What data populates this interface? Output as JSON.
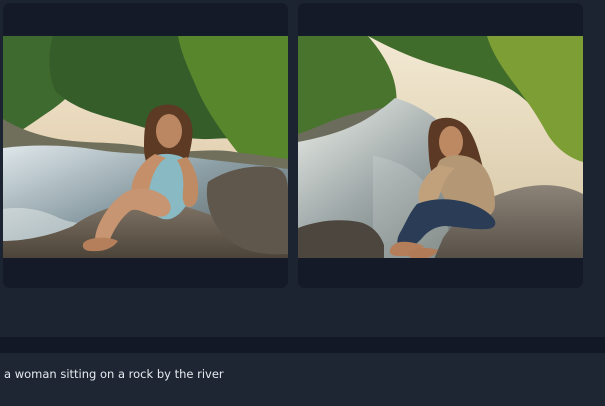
{
  "gallery": {
    "images": [
      {
        "id": "left",
        "scene": "woman-sitting-on-rock-by-river-front-view"
      },
      {
        "id": "right",
        "scene": "woman-sitting-on-rock-by-river-side-view"
      }
    ]
  },
  "prompt": {
    "text": "a woman sitting on a rock by the river"
  },
  "colors": {
    "background": "#1c2431",
    "card": "#151c2b",
    "text": "#e6e9ef"
  }
}
